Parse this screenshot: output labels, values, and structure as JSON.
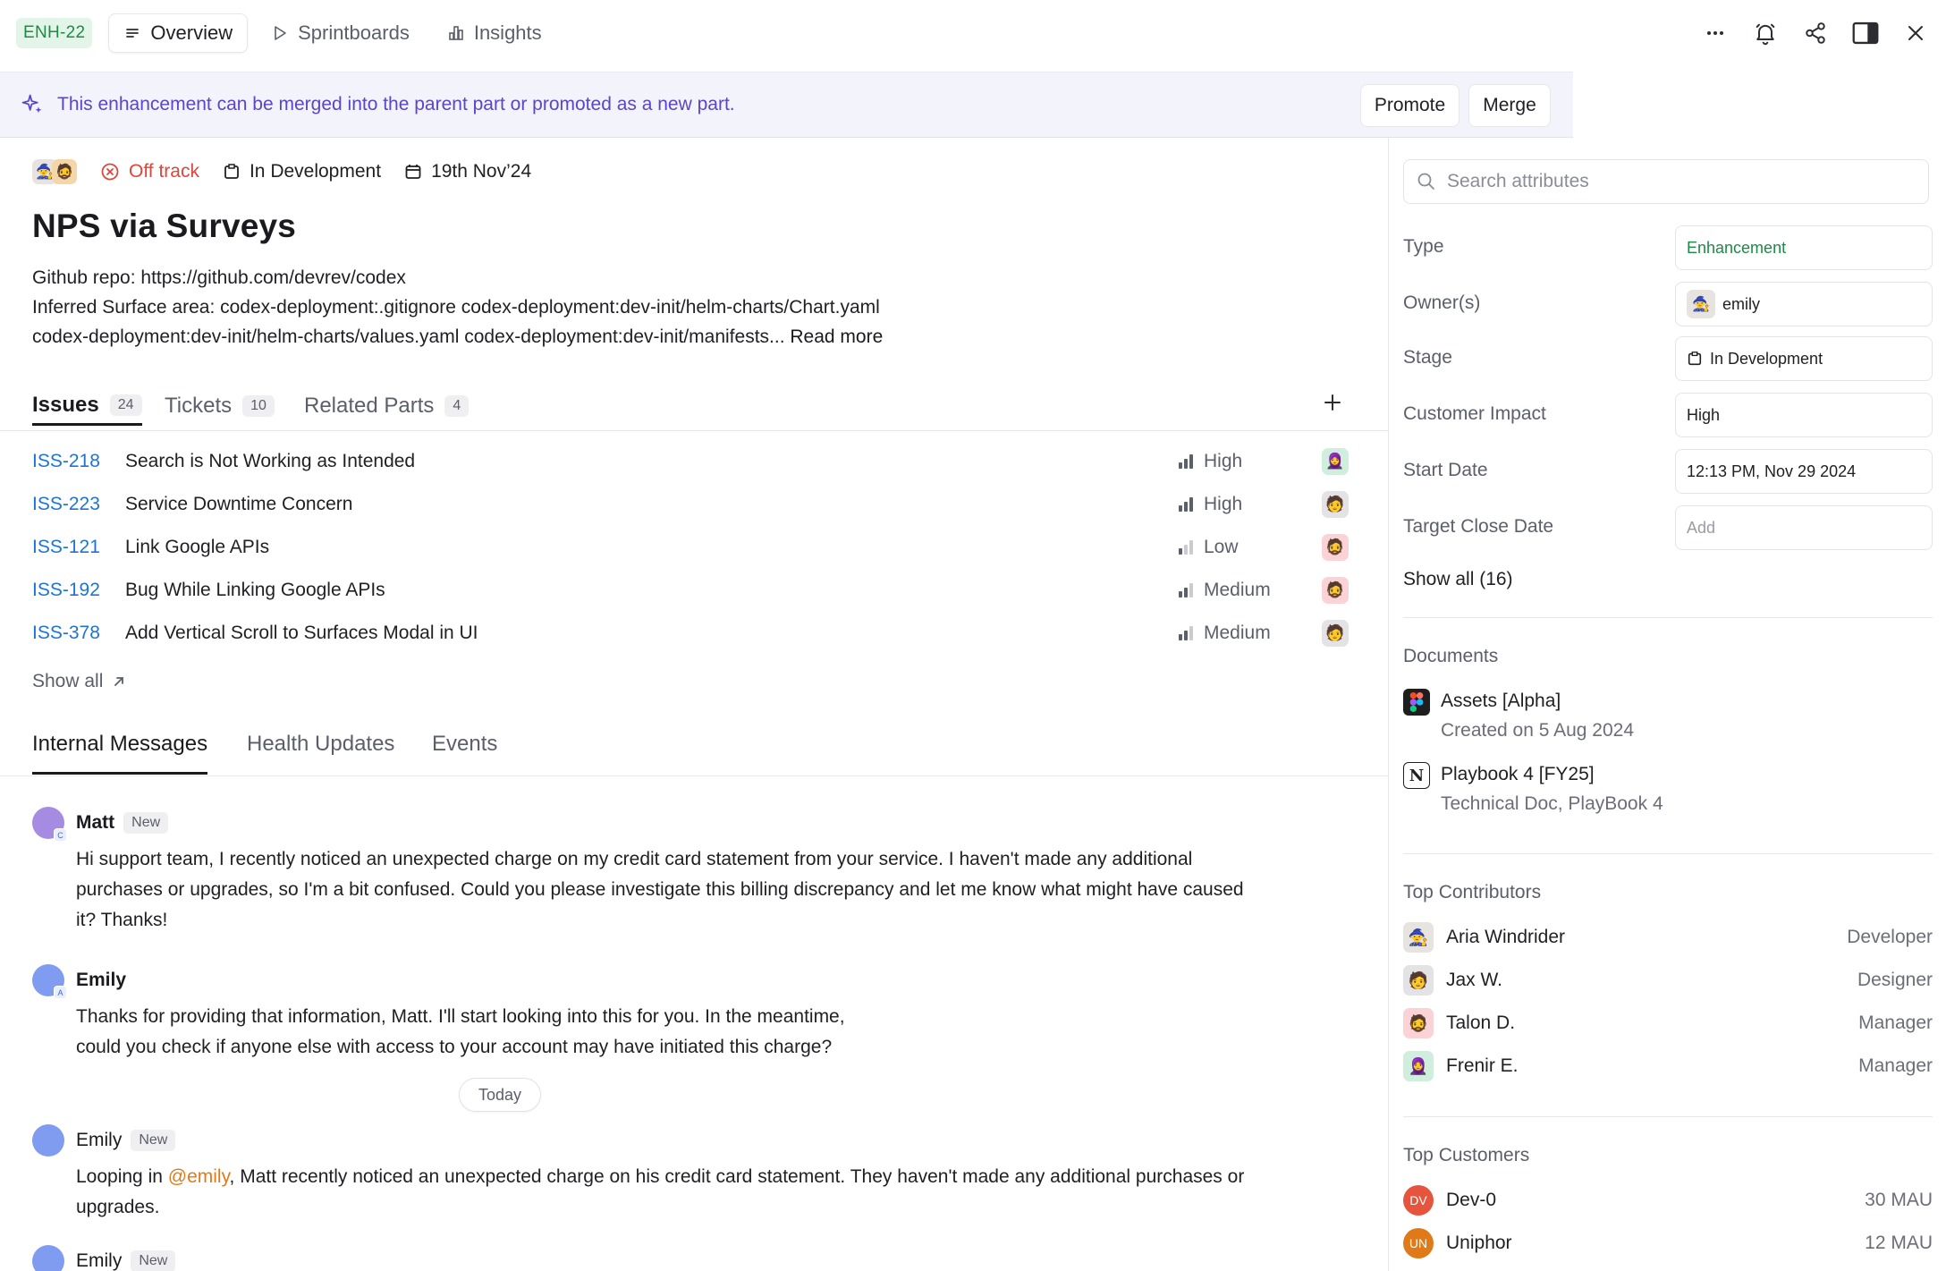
{
  "topbar": {
    "id": "ENH-22",
    "tabs": [
      {
        "label": "Overview",
        "icon": "list-icon"
      },
      {
        "label": "Sprintboards",
        "icon": "play-icon"
      },
      {
        "label": "Insights",
        "icon": "bar-chart-icon"
      }
    ],
    "actions": [
      "more-icon",
      "bell-icon",
      "share-icon",
      "panel-icon",
      "close-icon"
    ]
  },
  "banner": {
    "text": "This enhancement can be merged into the parent part or promoted as a new part.",
    "promote": "Promote",
    "merge": "Merge",
    "accent": "#5b45c8"
  },
  "meta": {
    "status": "Off track",
    "stage": "In Development",
    "date": "19th Nov’24"
  },
  "title": "NPS via Surveys",
  "description": {
    "line1": "Github repo: https://github.com/devrev/codex",
    "line2": "Inferred Surface area: codex-deployment:.gitignore codex-deployment:dev-init/helm-charts/Chart.yaml",
    "line3": "codex-deployment:dev-init/helm-charts/values.yaml codex-deployment:dev-init/manifests...",
    "read_more": "Read more"
  },
  "work_tabs": [
    {
      "label": "Issues",
      "count": "24"
    },
    {
      "label": "Tickets",
      "count": "10"
    },
    {
      "label": "Related Parts",
      "count": "4"
    }
  ],
  "issues": [
    {
      "id": "ISS-218",
      "title": "Search is Not Working as Intended",
      "priority": "High",
      "avatar": "🧕"
    },
    {
      "id": "ISS-223",
      "title": "Service Downtime Concern",
      "priority": "High",
      "avatar": "🧑"
    },
    {
      "id": "ISS-121",
      "title": "Link Google APIs",
      "priority": "Low",
      "avatar": "🧔"
    },
    {
      "id": "ISS-192",
      "title": "Bug While Linking Google APIs",
      "priority": "Medium",
      "avatar": "🧔"
    },
    {
      "id": "ISS-378",
      "title": "Add Vertical Scroll to Surfaces Modal in UI",
      "priority": "Medium",
      "avatar": "🧑"
    }
  ],
  "issues_show_all": "Show all",
  "msg_tabs": [
    "Internal Messages",
    "Health Updates",
    "Events"
  ],
  "messages": [
    {
      "name": "Matt",
      "badge": "New",
      "sub": "C",
      "line1": "Hi support team, I recently noticed an unexpected charge on my credit card statement from your service. I haven't made any additional",
      "line2": "purchases or upgrades, so I'm a bit confused. Could you please investigate this billing discrepancy and let me know what might have caused",
      "line3": "it? Thanks!"
    },
    {
      "name": "Emily",
      "badge": "",
      "sub": "A",
      "line1": "Thanks for providing that information, Matt. I'll start looking into this for you. In the meantime,",
      "line2": "could you check if anyone else with access to your account may have initiated this charge?"
    },
    {
      "name": "Emily",
      "badge": "New",
      "line1_pre": "Looping in ",
      "mention": "@emily",
      "line1_post": ", Matt recently noticed an unexpected charge on his credit card statement. They haven't made any additional purchases or",
      "line2": "upgrades."
    },
    {
      "name": "Emily",
      "badge": "New"
    }
  ],
  "today_label": "Today",
  "sidebar": {
    "search_placeholder": "Search attributes",
    "attributes": [
      {
        "label": "Type",
        "value": "Enhancement"
      },
      {
        "label": "Owner(s)",
        "value": "emily"
      },
      {
        "label": "Stage",
        "value": "In Development"
      },
      {
        "label": "Customer Impact",
        "value": "High"
      },
      {
        "label": "Start Date",
        "value": "12:13 PM, Nov 29 2024"
      },
      {
        "label": "Target Close Date",
        "value": "Add"
      }
    ],
    "show_all": "Show all (16)",
    "documents_title": "Documents",
    "documents": [
      {
        "title": "Assets [Alpha]",
        "sub": "Created on 5 Aug 2024",
        "icon": "figma-icon"
      },
      {
        "title": "Playbook 4 [FY25]",
        "sub": "Technical Doc, PlayBook 4",
        "icon": "notion-icon"
      }
    ],
    "contributors_title": "Top Contributors",
    "contributors": [
      {
        "name": "Aria Windrider",
        "role": "Developer",
        "avatar": "🧙"
      },
      {
        "name": "Jax W.",
        "role": "Designer",
        "avatar": "🧑"
      },
      {
        "name": "Talon D.",
        "role": "Manager",
        "avatar": "🧔"
      },
      {
        "name": "Frenir E.",
        "role": "Manager",
        "avatar": "🧕"
      }
    ],
    "customers_title": "Top Customers",
    "customers": [
      {
        "initials": "DV",
        "name": "Dev-0",
        "value": "30 MAU",
        "color": "#e5553d"
      },
      {
        "initials": "UN",
        "name": "Uniphor",
        "value": "12 MAU",
        "color": "#e07a18"
      }
    ]
  }
}
